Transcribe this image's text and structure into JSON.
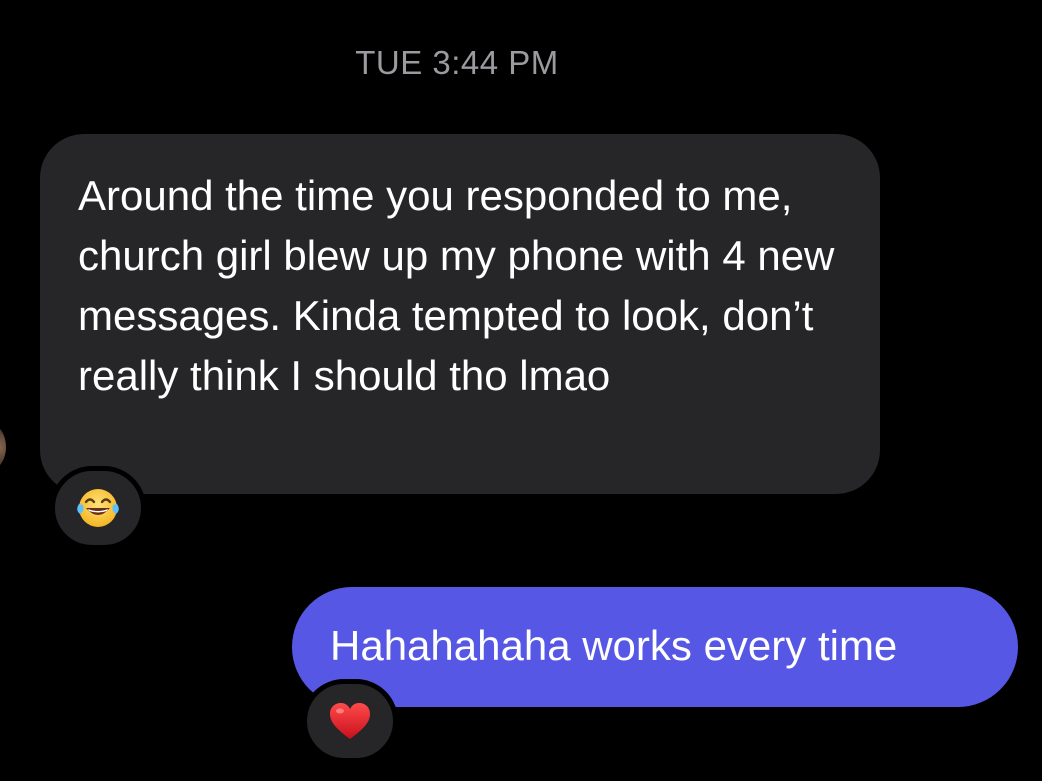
{
  "conversation": {
    "timestamp": "TUE 3:44 PM",
    "messages": [
      {
        "direction": "incoming",
        "text": "Around the time you responded to me, church girl blew up my phone with 4 new messages. Kinda tempted to look, don’t really think I should tho lmao",
        "reaction": "face-with-tears-of-joy-icon"
      },
      {
        "direction": "outgoing",
        "text": "Hahahahaha works every time",
        "reaction": "red-heart-icon"
      }
    ]
  },
  "colors": {
    "background": "#000000",
    "incoming_bubble": "#262628",
    "outgoing_bubble": "#5657e4",
    "timestamp_text": "#9a9a9f",
    "message_text": "#ffffff"
  }
}
